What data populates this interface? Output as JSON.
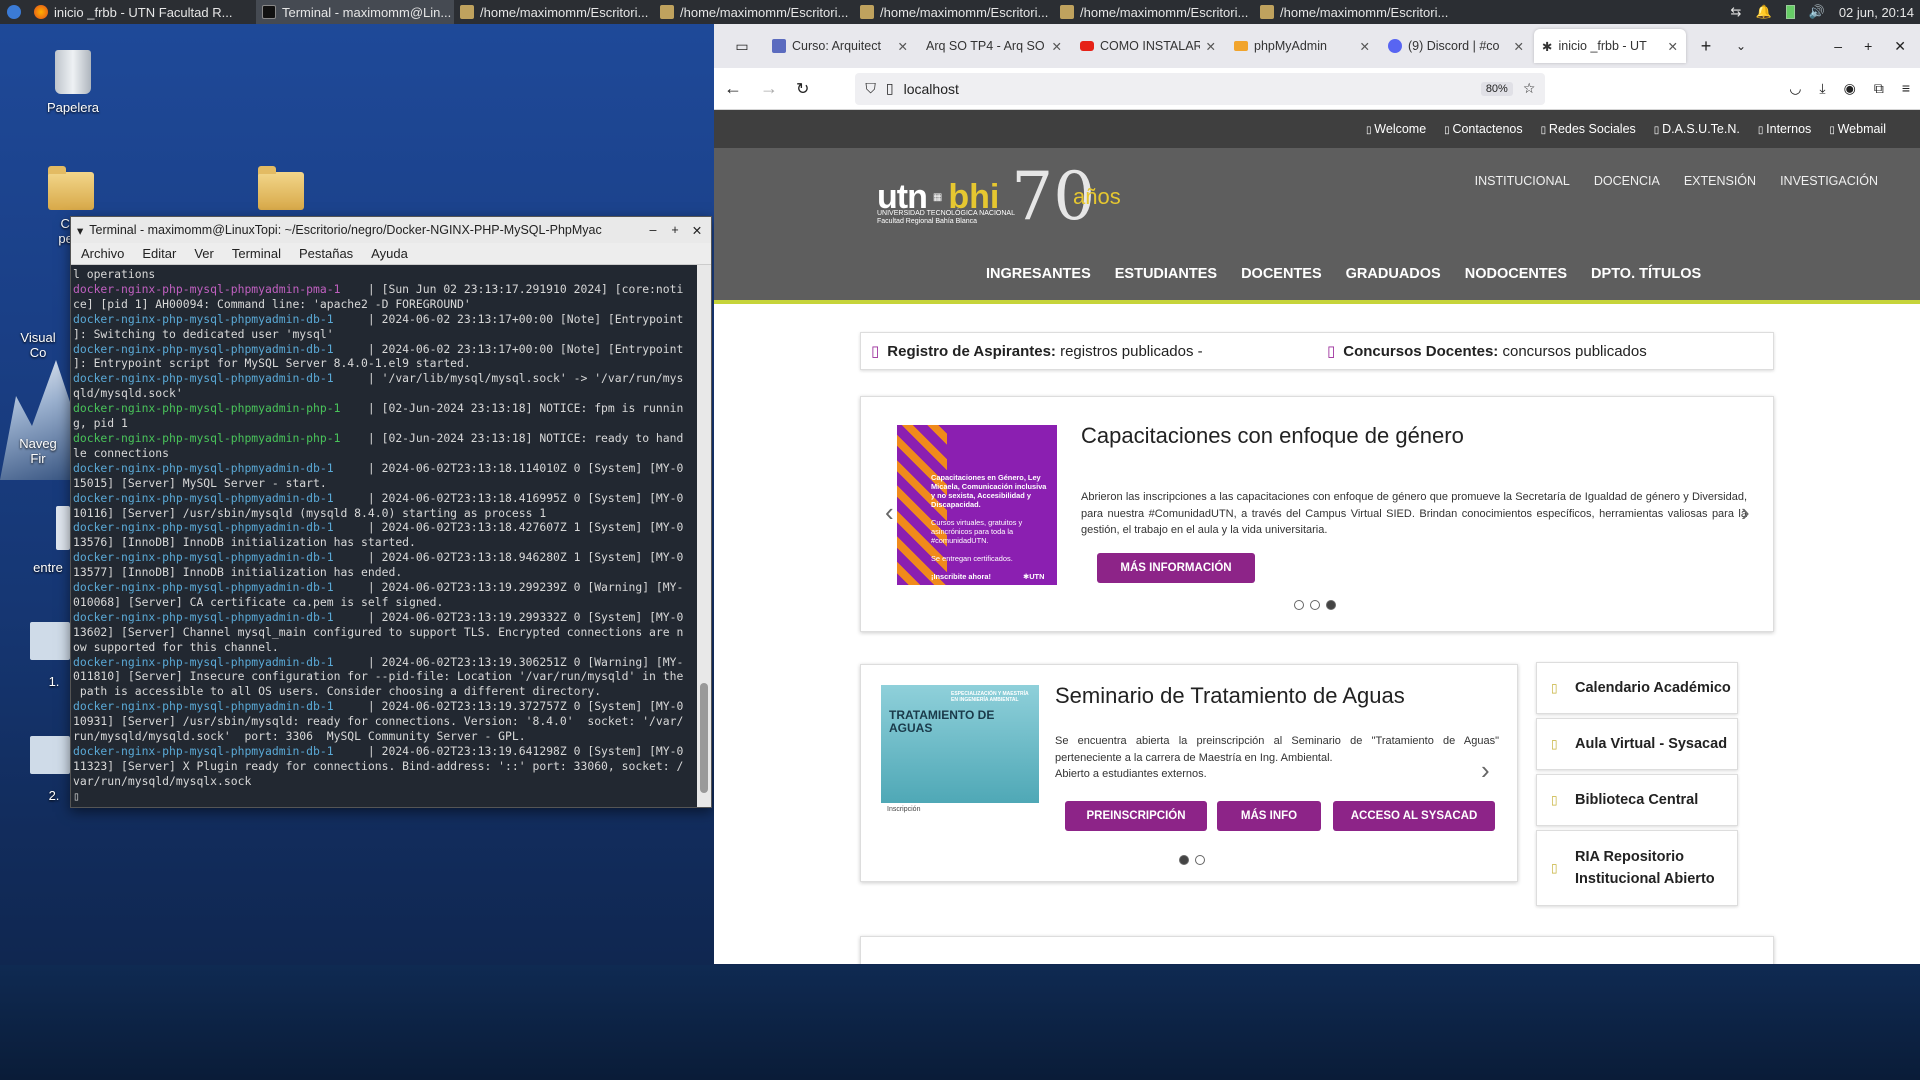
{
  "taskbar": {
    "items": [
      {
        "label": "inicio _frbb - UTN Facultad R...",
        "icon": "firefox-icon",
        "active": false
      },
      {
        "label": "Terminal - maximomm@Lin...",
        "icon": "terminal-icon",
        "active": true
      },
      {
        "label": "/home/maximomm/Escritori...",
        "icon": "folder-icon",
        "active": false
      },
      {
        "label": "/home/maximomm/Escritori...",
        "icon": "folder-icon",
        "active": false
      },
      {
        "label": "/home/maximomm/Escritori...",
        "icon": "folder-icon",
        "active": false
      },
      {
        "label": "/home/maximomm/Escritori...",
        "icon": "folder-icon",
        "active": false
      },
      {
        "label": "/home/maximomm/Escritori...",
        "icon": "folder-icon",
        "active": false
      }
    ],
    "clock": "02 jun, 20:14"
  },
  "desktop": {
    "trash_label": "Papelera",
    "partial_labels": [
      "Car",
      "pers",
      "Visual",
      "Co",
      "Naveg",
      "Fir",
      "entre",
      "1.",
      "2."
    ]
  },
  "terminal": {
    "title": "Terminal - maximomm@LinuxTopi: ~/Escritorio/negro/Docker-NGINX-PHP-MySQL-PhpMyac",
    "menu": [
      "Archivo",
      "Editar",
      "Ver",
      "Terminal",
      "Pestañas",
      "Ayuda"
    ],
    "lines": [
      {
        "p": "",
        "c": "",
        "t": "l operations"
      },
      {
        "p": "docker-nginx-php-mysql-phpmyadmin-pma-1",
        "c": "pma",
        "t": "    | [Sun Jun 02 23:13:17.291910 2024] [core:noti"
      },
      {
        "p": "",
        "c": "",
        "t": "ce] [pid 1] AH00094: Command line: 'apache2 -D FOREGROUND'"
      },
      {
        "p": "docker-nginx-php-mysql-phpmyadmin-db-1",
        "c": "db",
        "t": "     | 2024-06-02 23:13:17+00:00 [Note] [Entrypoint"
      },
      {
        "p": "",
        "c": "",
        "t": "]: Switching to dedicated user 'mysql'"
      },
      {
        "p": "docker-nginx-php-mysql-phpmyadmin-db-1",
        "c": "db",
        "t": "     | 2024-06-02 23:13:17+00:00 [Note] [Entrypoint"
      },
      {
        "p": "",
        "c": "",
        "t": "]: Entrypoint script for MySQL Server 8.4.0-1.el9 started."
      },
      {
        "p": "docker-nginx-php-mysql-phpmyadmin-db-1",
        "c": "db",
        "t": "     | '/var/lib/mysql/mysql.sock' -> '/var/run/mys"
      },
      {
        "p": "",
        "c": "",
        "t": "qld/mysqld.sock'"
      },
      {
        "p": "docker-nginx-php-mysql-phpmyadmin-php-1",
        "c": "php",
        "t": "    | [02-Jun-2024 23:13:18] NOTICE: fpm is runnin"
      },
      {
        "p": "",
        "c": "",
        "t": "g, pid 1"
      },
      {
        "p": "docker-nginx-php-mysql-phpmyadmin-php-1",
        "c": "php",
        "t": "    | [02-Jun-2024 23:13:18] NOTICE: ready to hand"
      },
      {
        "p": "",
        "c": "",
        "t": "le connections"
      },
      {
        "p": "docker-nginx-php-mysql-phpmyadmin-db-1",
        "c": "db",
        "t": "     | 2024-06-02T23:13:18.114010Z 0 [System] [MY-0"
      },
      {
        "p": "",
        "c": "",
        "t": "15015] [Server] MySQL Server - start."
      },
      {
        "p": "docker-nginx-php-mysql-phpmyadmin-db-1",
        "c": "db",
        "t": "     | 2024-06-02T23:13:18.416995Z 0 [System] [MY-0"
      },
      {
        "p": "",
        "c": "",
        "t": "10116] [Server] /usr/sbin/mysqld (mysqld 8.4.0) starting as process 1"
      },
      {
        "p": "docker-nginx-php-mysql-phpmyadmin-db-1",
        "c": "db",
        "t": "     | 2024-06-02T23:13:18.427607Z 1 [System] [MY-0"
      },
      {
        "p": "",
        "c": "",
        "t": "13576] [InnoDB] InnoDB initialization has started."
      },
      {
        "p": "docker-nginx-php-mysql-phpmyadmin-db-1",
        "c": "db",
        "t": "     | 2024-06-02T23:13:18.946280Z 1 [System] [MY-0"
      },
      {
        "p": "",
        "c": "",
        "t": "13577] [InnoDB] InnoDB initialization has ended."
      },
      {
        "p": "docker-nginx-php-mysql-phpmyadmin-db-1",
        "c": "db",
        "t": "     | 2024-06-02T23:13:19.299239Z 0 [Warning] [MY-"
      },
      {
        "p": "",
        "c": "",
        "t": "010068] [Server] CA certificate ca.pem is self signed."
      },
      {
        "p": "docker-nginx-php-mysql-phpmyadmin-db-1",
        "c": "db",
        "t": "     | 2024-06-02T23:13:19.299332Z 0 [System] [MY-0"
      },
      {
        "p": "",
        "c": "",
        "t": "13602] [Server] Channel mysql_main configured to support TLS. Encrypted connections are n"
      },
      {
        "p": "",
        "c": "",
        "t": "ow supported for this channel."
      },
      {
        "p": "docker-nginx-php-mysql-phpmyadmin-db-1",
        "c": "db",
        "t": "     | 2024-06-02T23:13:19.306251Z 0 [Warning] [MY-"
      },
      {
        "p": "",
        "c": "",
        "t": "011810] [Server] Insecure configuration for --pid-file: Location '/var/run/mysqld' in the"
      },
      {
        "p": "",
        "c": "",
        "t": " path is accessible to all OS users. Consider choosing a different directory."
      },
      {
        "p": "docker-nginx-php-mysql-phpmyadmin-db-1",
        "c": "db",
        "t": "     | 2024-06-02T23:13:19.372757Z 0 [System] [MY-0"
      },
      {
        "p": "",
        "c": "",
        "t": "10931] [Server] /usr/sbin/mysqld: ready for connections. Version: '8.4.0'  socket: '/var/"
      },
      {
        "p": "",
        "c": "",
        "t": "run/mysqld/mysqld.sock'  port: 3306  MySQL Community Server - GPL."
      },
      {
        "p": "docker-nginx-php-mysql-phpmyadmin-db-1",
        "c": "db",
        "t": "     | 2024-06-02T23:13:19.641298Z 0 [System] [MY-0"
      },
      {
        "p": "",
        "c": "",
        "t": "11323] [Server] X Plugin ready for connections. Bind-address: '::' port: 33060, socket: /"
      },
      {
        "p": "",
        "c": "",
        "t": "var/run/mysqld/mysqlx.sock"
      },
      {
        "p": "",
        "c": "",
        "t": "▯"
      }
    ]
  },
  "browser": {
    "tabs": [
      {
        "label": "Curso: Arquitect",
        "icon": "moodle-icon",
        "active": false
      },
      {
        "label": "Arq SO TP4 - Arq SO",
        "icon": "page-icon",
        "active": false
      },
      {
        "label": "COMO INSTALAR",
        "icon": "youtube-icon",
        "active": false
      },
      {
        "label": "phpMyAdmin",
        "icon": "phpmyadmin-icon",
        "active": false
      },
      {
        "label": "(9) Discord | #co",
        "icon": "discord-icon",
        "active": false
      },
      {
        "label": "inicio _frbb - UT",
        "icon": "utn-icon",
        "active": true
      }
    ],
    "url": "localhost",
    "zoom": "80%"
  },
  "site": {
    "topstrip": [
      "Welcome",
      "Contactenos",
      "Redes Sociales",
      "D.A.S.U.Te.N.",
      "Internos",
      "Webmail"
    ],
    "logo": {
      "utn": "utn",
      "bhi": "bhi",
      "sub1": "UNIVERSIDAD TECNOLÓGICA NACIONAL",
      "sub2": "Facultad Regional Bahía Blanca",
      "years": "70",
      "anios": "años"
    },
    "topnav": [
      "INSTITUCIONAL",
      "DOCENCIA",
      "EXTENSIÓN",
      "INVESTIGACIÓN"
    ],
    "mainnav": [
      "INGRESANTES",
      "ESTUDIANTES",
      "DOCENTES",
      "GRADUADOS",
      "NODOCENTES",
      "DPTO. TÍTULOS"
    ],
    "notice1_bold": "Registro de Aspirantes:",
    "notice1_text": " registros publicados -",
    "notice2_bold": "Concursos Docentes:",
    "notice2_text": " concursos publicados",
    "card1": {
      "title": "Capacitaciones con enfoque de género",
      "text": "Abrieron las inscripciones a las capacitaciones con enfoque de género que promueve la Secretaría de Igualdad de género y Diversidad, para nuestra #ComunidadUTN, a través del Campus Virtual SIED. Brindan conocimientos específicos, herramientas valiosas para la gestión, el trabajo en el aula y la vida universitaria.",
      "button": "MÁS INFORMACIÓN",
      "promo_text": "Capacitaciones en Género, Ley Micaela, Comunicación inclusiva y no sexista, Accesibilidad y Discapacidad.",
      "promo_sub": "Cursos virtuales, gratuitos y asincrónicos para toda la #comunidadUTN.",
      "promo_cert": "Se entregan certificados.",
      "promo_cta": "¡Inscribite ahora!",
      "promo_brand": "✱UTN"
    },
    "card2": {
      "title": "Seminario de Tratamiento de Aguas",
      "text": "Se encuentra abierta la preinscripción al Seminario de \"Tratamiento de Aguas\" perteneciente a la carrera de Maestría en Ing. Ambiental.",
      "text2": "Abierto a estudiantes externos.",
      "buttons": [
        "PREINSCRIPCIÓN",
        "MÁS INFO",
        "ACCESO AL SYSACAD"
      ],
      "promo_title": "TRATAMIENTO DE AGUAS",
      "promo_sub": "ESPECIALIZACIÓN Y MAESTRÍA EN INGENIERÍA AMBIENTAL",
      "promo_foot": "Inscripción"
    },
    "sidebar": [
      "Calendario Académico",
      "Aula Virtual - Sysacad",
      "Biblioteca Central",
      "RIA Repositorio Institucional Abierto"
    ]
  }
}
